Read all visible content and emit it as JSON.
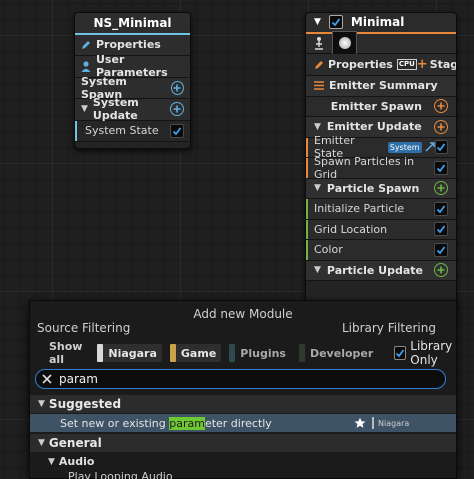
{
  "system_node": {
    "title": "NS_Minimal",
    "items": [
      {
        "label": "Properties"
      },
      {
        "label": "User Parameters"
      },
      {
        "label": "System Spawn"
      },
      {
        "label": "System Update"
      },
      {
        "label": "System State"
      }
    ]
  },
  "emitter_node": {
    "title": "Minimal",
    "properties_label": "Properties",
    "cpu_label": "CPU",
    "stage_label": "Stage",
    "emitter_summary": "Emitter Summary",
    "emitter_spawn": "Emitter Spawn",
    "emitter_update": "Emitter Update",
    "emitter_state": "Emitter State",
    "system_badge": "System",
    "spawn_particles_in_grid": "Spawn Particles in Grid",
    "particle_spawn": "Particle Spawn",
    "initialize_particle": "Initialize Particle",
    "grid_location": "Grid Location",
    "color": "Color",
    "particle_update": "Particle Update"
  },
  "add_module": {
    "title": "Add new Module",
    "source_filtering": "Source Filtering",
    "library_filtering": "Library Filtering",
    "show_all": "Show all",
    "filters": {
      "niagara": "Niagara",
      "game": "Game",
      "plugins": "Plugins",
      "developer": "Developer"
    },
    "library_only": "Library Only",
    "search_value": "param",
    "suggested": "Suggested",
    "result": {
      "prefix": "Set new or existing ",
      "match": "param",
      "suffix": "eter directly",
      "source": "Niagara"
    },
    "general": "General",
    "audio": "Audio",
    "partial_item": "Play Looping Audio"
  },
  "colors": {
    "system_accent": "#6ec3e6",
    "emitter_accent": "#e8883a",
    "spawn_accent": "#6cb543",
    "checkbox_accent": "#3fa0f0",
    "search_border": "#2f7fd9",
    "highlight": "#6ec832"
  }
}
